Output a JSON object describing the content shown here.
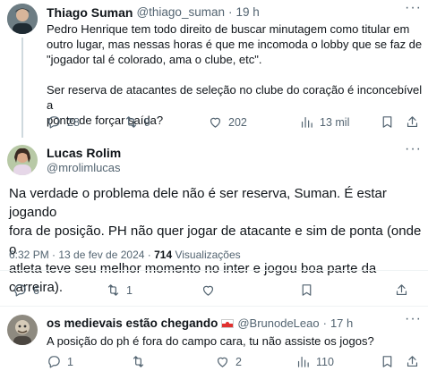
{
  "tweet1": {
    "display_name": "Thiago Suman",
    "handle": "@thiago_suman",
    "separator": "·",
    "time": "19 h",
    "lines": [
      "Pedro Henrique tem todo direito de buscar minutagem como titular em",
      "outro lugar, mas nessas horas é que me incomoda o lobby que se faz de",
      "\"jogador tal é colorado, ama o clube, etc\".",
      "",
      "Ser reserva de atacantes de seleção no clube do coração é inconcebível a",
      "ponto de forçar saída?"
    ],
    "replies": "28",
    "retweets": "9",
    "likes": "202",
    "views": "13 mil"
  },
  "tweet2": {
    "display_name": "Lucas Rolim",
    "handle": "@mrolimlucas",
    "lines": [
      "Na verdade o problema dele não é ser reserva, Suman. É estar jogando",
      "fora de posição. PH não quer jogar de atacante e sim de ponta (onde o",
      "atleta teve seu melhor momento no inter e jogou boa parte da carreira)."
    ],
    "timestamp": "6:32 PM · 13 de fev de 2024 · ",
    "views_count": "714",
    "views_label": " Visualizações",
    "replies": "6",
    "retweets": "1"
  },
  "tweet3": {
    "display_name": "os medievais estão chegando",
    "handle": "@BrunodeLeao",
    "separator": "·",
    "time": "17 h",
    "text": "A posição do ph é fora do campo cara, tu não assiste os jogos?",
    "replies": "1",
    "likes": "2",
    "views": "110"
  },
  "colors": {
    "accent": "#1d9bf0",
    "muted": "#536471",
    "divider": "#eff3f4"
  },
  "icons": [
    "more-icon",
    "reply-icon",
    "retweet-icon",
    "like-icon",
    "views-icon",
    "bookmark-icon",
    "share-icon",
    "emoji-flag-icon"
  ]
}
